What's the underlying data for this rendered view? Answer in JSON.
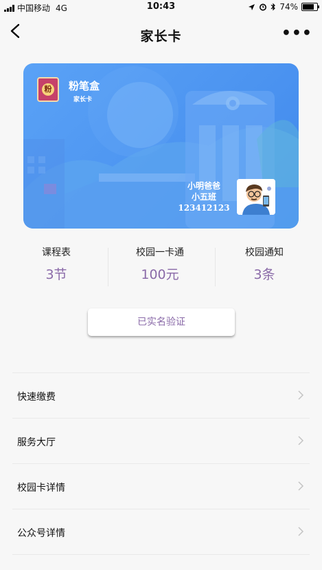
{
  "status_bar": {
    "carrier": "中国移动",
    "network": "4G",
    "time": "10:43",
    "battery": "74%"
  },
  "nav": {
    "title": "家长卡",
    "more_label": "•••"
  },
  "card": {
    "brand_name": "粉笔盒",
    "brand_subtitle": "家长卡",
    "logo_glyph": "粉",
    "holder_name": "小明爸爸",
    "class_name": "小五班",
    "card_number": "123412123"
  },
  "stats": [
    {
      "label": "课程表",
      "value": "3节"
    },
    {
      "label": "校园一卡通",
      "value": "100元"
    },
    {
      "label": "校园通知",
      "value": "3条"
    }
  ],
  "verify_label": "已实名验证",
  "menu": [
    {
      "label": "快速缴费"
    },
    {
      "label": "服务大厅"
    },
    {
      "label": "校园卡详情"
    },
    {
      "label": "公众号详情"
    }
  ],
  "colors": {
    "card_blue": "#4b93f0",
    "accent_purple": "#8a6aa8",
    "background": "#f7f7f7"
  }
}
